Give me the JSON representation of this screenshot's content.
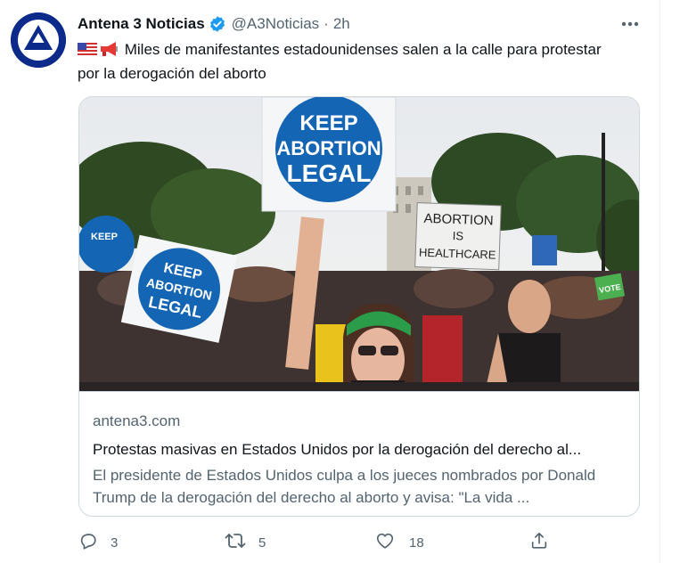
{
  "tweet": {
    "author": {
      "display_name": "Antena 3 Noticias",
      "handle": "@A3Noticias",
      "verified": true,
      "avatar_icon": "antena3-logo-icon"
    },
    "separator": "·",
    "time": "2h",
    "text": "Miles de manifestantes estadounidenses salen a la calle para protestar por la derogación del aborto",
    "text_emojis": [
      "us-flag-emoji",
      "megaphone-emoji"
    ],
    "more_icon": "ellipsis-icon",
    "card": {
      "image_signs": [
        "KEEP",
        "ABORTION",
        "LEGAL",
        "ABORTION",
        "IS",
        "HEALTHCARE",
        "VOTE"
      ],
      "domain": "antena3.com",
      "title": "Protestas masivas en Estados Unidos por la derogación del derecho al...",
      "description": "El presidente de Estados Unidos culpa a los jueces nombrados por Donald Trump de la derogación del derecho al aborto y avisa: \"La vida ..."
    },
    "actions": {
      "reply": {
        "icon": "reply-icon",
        "count": "3"
      },
      "retweet": {
        "icon": "retweet-icon",
        "count": "5"
      },
      "like": {
        "icon": "heart-icon",
        "count": "18"
      },
      "share": {
        "icon": "share-icon"
      }
    }
  },
  "colors": {
    "text_primary": "#0f1419",
    "text_secondary": "#536471",
    "verified_blue": "#1d9bf0",
    "border": "#cfd9de",
    "avatar_bg": "#0b2a8a"
  }
}
